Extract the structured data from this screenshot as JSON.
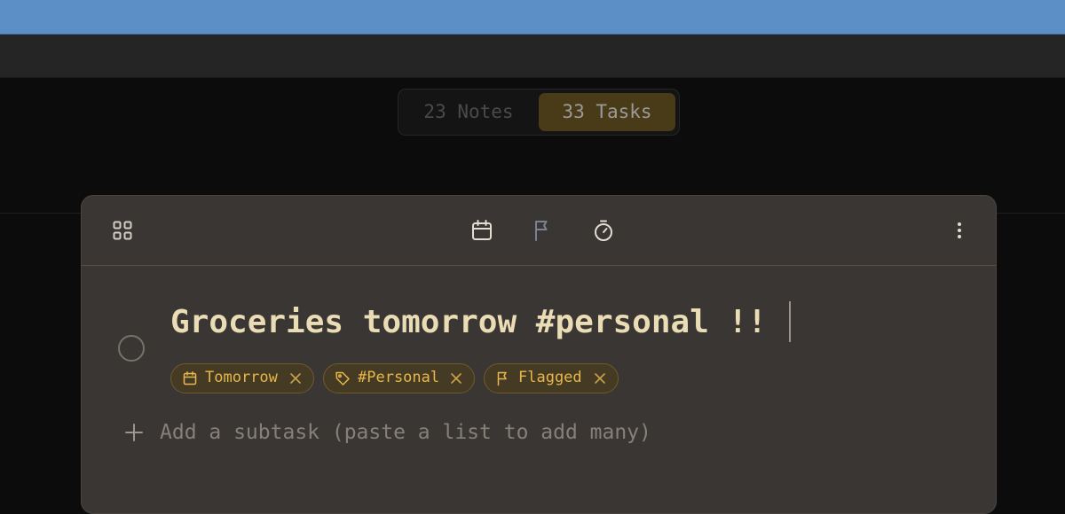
{
  "segment": {
    "notes_label": "23 Notes",
    "tasks_label": "33 Tasks",
    "active": "tasks"
  },
  "toolbar": {
    "icons": [
      "grid-icon",
      "calendar-icon",
      "flag-icon",
      "timer-icon",
      "more-vertical-icon"
    ]
  },
  "task": {
    "title": "Groceries tomorrow #personal !!",
    "completed": false,
    "chips": [
      {
        "icon": "calendar-icon",
        "label": "Tomorrow"
      },
      {
        "icon": "tag-icon",
        "label": "#Personal"
      },
      {
        "icon": "flag-icon",
        "label": "Flagged"
      }
    ]
  },
  "subtask": {
    "placeholder": "Add a subtask (paste a list to add many)"
  },
  "colors": {
    "chip_accent": "#e8b64a",
    "title_text": "#eadcb4",
    "active_segment": "#4a3b18",
    "panel_bg": "#3a3633"
  }
}
